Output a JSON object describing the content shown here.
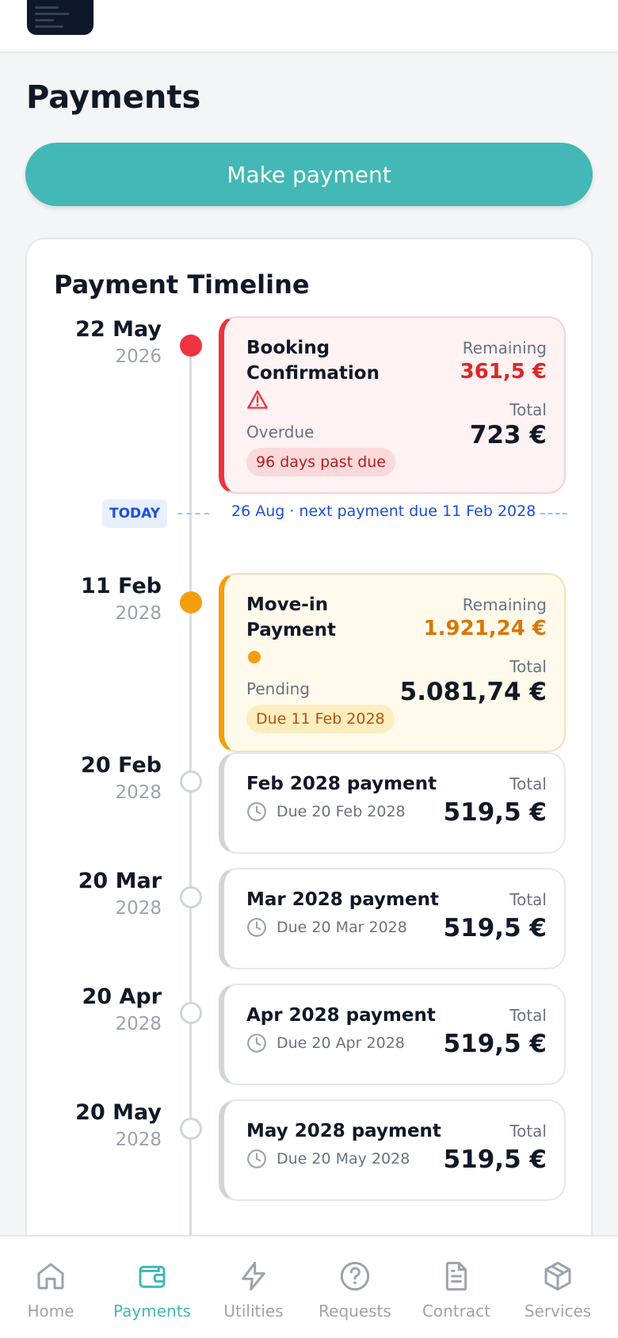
{
  "page": {
    "title": "Payments"
  },
  "actions": {
    "make_payment": "Make payment"
  },
  "timeline": {
    "title": "Payment Timeline",
    "today": {
      "badge": "TODAY",
      "text": "26 Aug · next payment due 11 Feb 2028"
    },
    "entries": [
      {
        "day": "22 May",
        "year": "2026",
        "name": "Booking Confirmation",
        "remaining_label": "Remaining",
        "remaining": "361,5 €",
        "total_label": "Total",
        "total": "723 €",
        "status": "Overdue",
        "pill": "96 days past due",
        "icon": "warning-icon"
      },
      {
        "day": "11 Feb",
        "year": "2028",
        "name_line1": "Move-in",
        "name_line2": "Payment",
        "remaining_label": "Remaining",
        "remaining": "1.921,24 €",
        "total_label": "Total",
        "total": "5.081,74 €",
        "status": "Pending",
        "pill": "Due 11 Feb 2028",
        "icon": "pending-dot-icon"
      },
      {
        "day": "20 Feb",
        "year": "2028",
        "name": "Feb 2028 payment",
        "due": "Due 20 Feb 2028",
        "total_label": "Total",
        "total": "519,5 €"
      },
      {
        "day": "20 Mar",
        "year": "2028",
        "name": "Mar 2028 payment",
        "due": "Due 20 Mar 2028",
        "total_label": "Total",
        "total": "519,5 €"
      },
      {
        "day": "20 Apr",
        "year": "2028",
        "name": "Apr 2028 payment",
        "due": "Due 20 Apr 2028",
        "total_label": "Total",
        "total": "519,5 €"
      },
      {
        "day": "20 May",
        "year": "2028",
        "name": "May 2028 payment",
        "due": "Due 20 May 2028",
        "total_label": "Total",
        "total": "519,5 €"
      }
    ]
  },
  "nav": {
    "items": [
      {
        "label": "Home",
        "icon": "home-icon"
      },
      {
        "label": "Payments",
        "icon": "wallet-icon",
        "active": true
      },
      {
        "label": "Utilities",
        "icon": "bolt-icon"
      },
      {
        "label": "Requests",
        "icon": "question-icon"
      },
      {
        "label": "Contract",
        "icon": "document-icon"
      },
      {
        "label": "Services",
        "icon": "box-icon"
      }
    ]
  },
  "colors": {
    "accent": "#43b8b6",
    "overdue": "#ef3340",
    "pending": "#f59e0b",
    "today": "#1d4ed8"
  }
}
